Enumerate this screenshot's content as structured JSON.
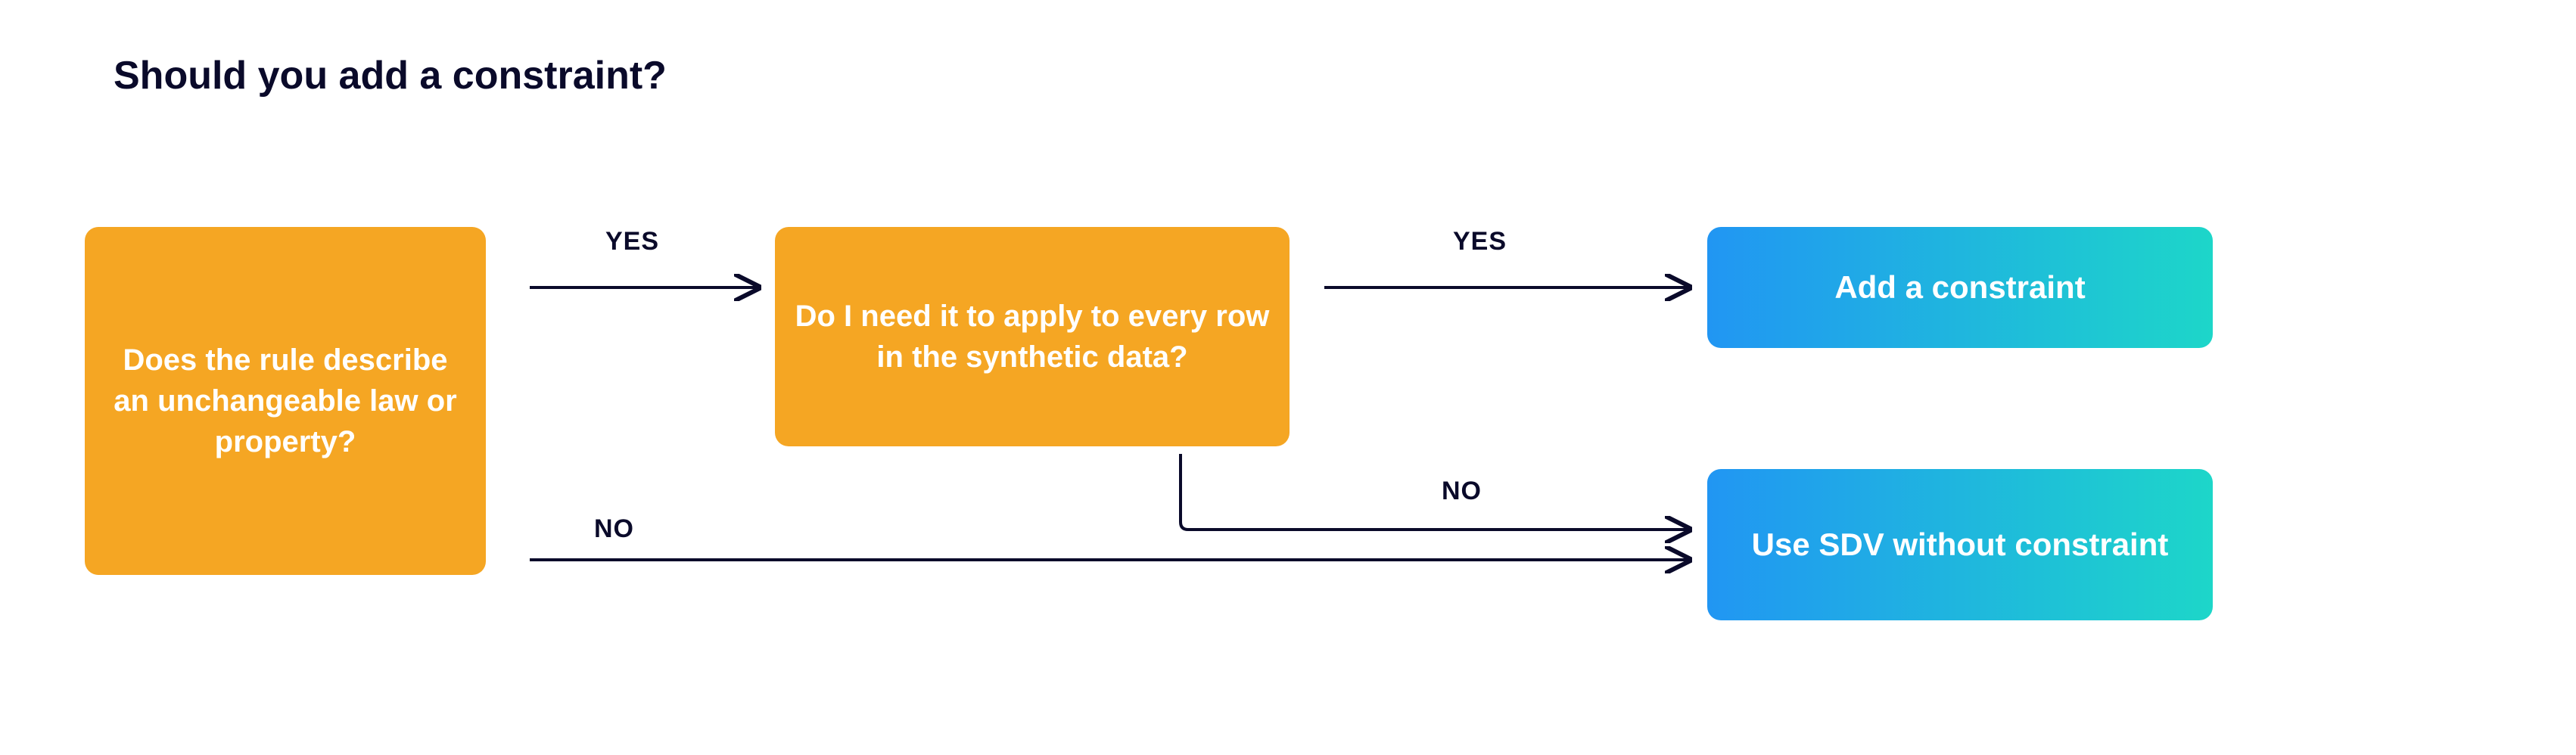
{
  "title": "Should you add a constraint?",
  "nodes": {
    "q1": "Does the rule describe an unchangeable law or property?",
    "q2": "Do I need it to apply to every row in the synthetic data?",
    "out_yes": "Add a constraint",
    "out_no": "Use SDV without constraint"
  },
  "labels": {
    "yes1": "YES",
    "yes2": "YES",
    "no1": "NO",
    "no2": "NO"
  },
  "chart_data": {
    "type": "diagram",
    "title": "Should you add a constraint?",
    "nodes": [
      {
        "id": "q1",
        "type": "decision",
        "text": "Does the rule describe an unchangeable law or property?"
      },
      {
        "id": "q2",
        "type": "decision",
        "text": "Do I need it to apply to every row in the synthetic data?"
      },
      {
        "id": "out_yes",
        "type": "outcome",
        "text": "Add a constraint"
      },
      {
        "id": "out_no",
        "type": "outcome",
        "text": "Use SDV without constraint"
      }
    ],
    "edges": [
      {
        "from": "q1",
        "to": "q2",
        "label": "YES"
      },
      {
        "from": "q1",
        "to": "out_no",
        "label": "NO"
      },
      {
        "from": "q2",
        "to": "out_yes",
        "label": "YES"
      },
      {
        "from": "q2",
        "to": "out_no",
        "label": "NO"
      }
    ]
  }
}
